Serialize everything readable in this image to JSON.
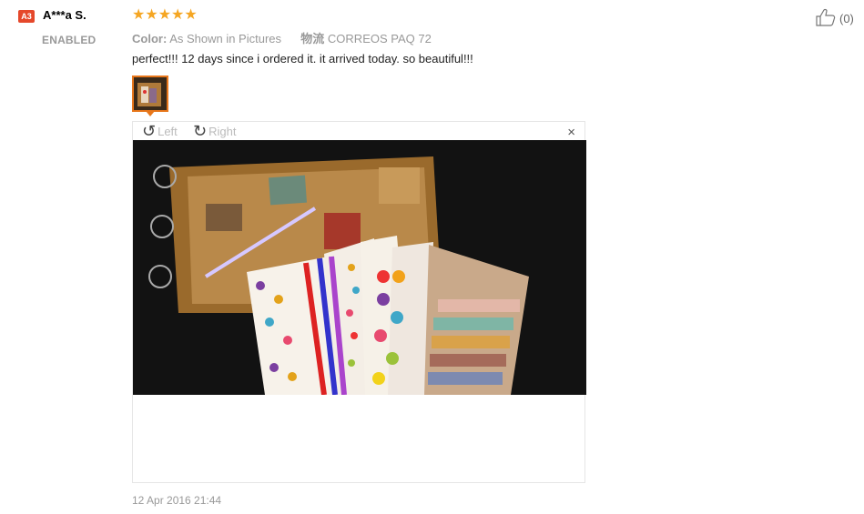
{
  "reviewer": {
    "badge": "A3",
    "name": "A***a S.",
    "status": "ENABLED"
  },
  "rating": {
    "stars_text": "★★★★★",
    "value": 5,
    "max": 5,
    "color": "#f5a623"
  },
  "meta": {
    "color_label": "Color:",
    "color_value": "As Shown in Pictures",
    "shipping_label": "物流",
    "shipping_value": "CORREOS PAQ 72"
  },
  "review_text": "perfect!!! 12 days since i ordered it. it arrived today. so beautiful!!!",
  "viewer": {
    "rotate_left_label": "Left",
    "rotate_right_label": "Right",
    "close_symbol": "×"
  },
  "date": "12 Apr 2016 21:44",
  "helpful": {
    "count": "(0)"
  },
  "colors": {
    "accent": "#e8771b",
    "badge": "#e5482b"
  }
}
